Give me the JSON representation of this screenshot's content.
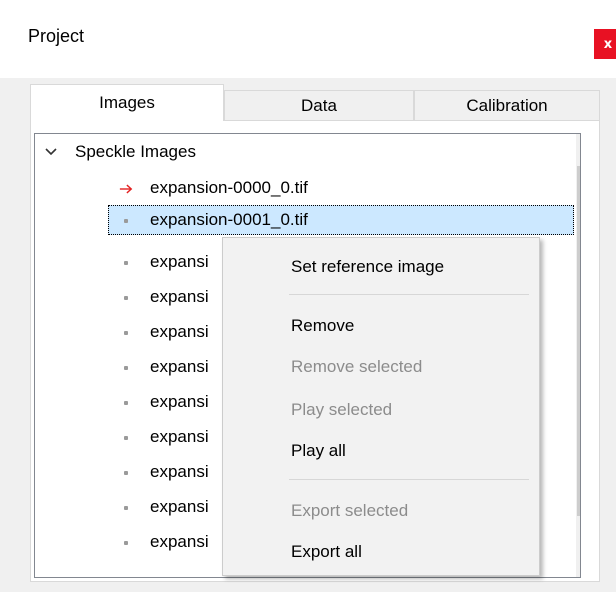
{
  "window": {
    "title": "Project",
    "close_label": "x"
  },
  "tabs": [
    {
      "label": "Images",
      "active": true
    },
    {
      "label": "Data",
      "active": false
    },
    {
      "label": "Calibration",
      "active": false
    }
  ],
  "tree": {
    "root_label": "Speckle Images",
    "items": [
      {
        "label": "expansion-0000_0.tif",
        "icon": "reference-arrow-icon"
      },
      {
        "label": "expansion-0001_0.tif",
        "icon": "bullet-icon",
        "selected": true
      },
      {
        "label": "expansi",
        "icon": "bullet-icon"
      },
      {
        "label": "expansi",
        "icon": "bullet-icon"
      },
      {
        "label": "expansi",
        "icon": "bullet-icon"
      },
      {
        "label": "expansi",
        "icon": "bullet-icon"
      },
      {
        "label": "expansi",
        "icon": "bullet-icon"
      },
      {
        "label": "expansi",
        "icon": "bullet-icon"
      },
      {
        "label": "expansi",
        "icon": "bullet-icon"
      },
      {
        "label": "expansi",
        "icon": "bullet-icon"
      },
      {
        "label": "expansi",
        "icon": "bullet-icon"
      }
    ]
  },
  "context_menu": {
    "items": [
      {
        "label": "Set reference image",
        "enabled": true
      },
      {
        "label": "Remove",
        "enabled": true
      },
      {
        "label": "Remove selected",
        "enabled": false
      },
      {
        "label": "Play selected",
        "enabled": false
      },
      {
        "label": "Play all",
        "enabled": true
      },
      {
        "label": "Export selected",
        "enabled": false
      },
      {
        "label": "Export all",
        "enabled": true
      }
    ]
  },
  "colors": {
    "close_button": "#e81123",
    "selection": "#cce8ff",
    "reference_arrow": "#e32020",
    "disabled_text": "#8c8c8c"
  }
}
